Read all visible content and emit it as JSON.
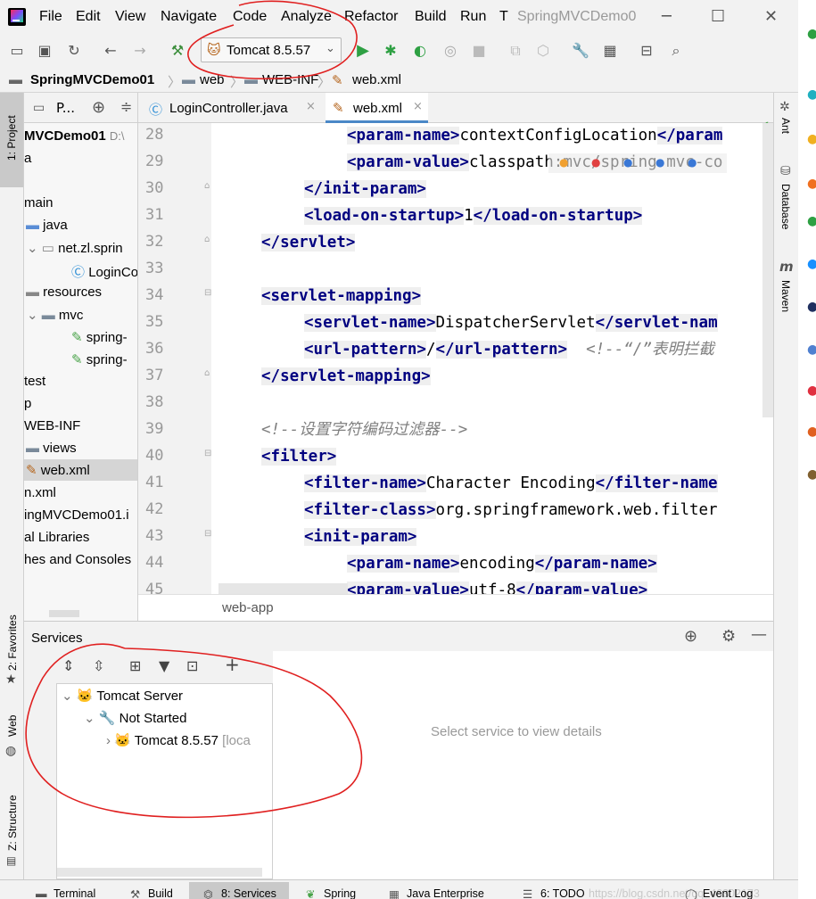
{
  "window": {
    "title": "SpringMVCDemo0"
  },
  "menu": [
    "File",
    "Edit",
    "View",
    "Navigate",
    "Code",
    "Analyze",
    "Refactor",
    "Build",
    "Run",
    "T"
  ],
  "toolbar": {
    "run_config": "Tomcat 8.5.57"
  },
  "breadcrumb": [
    "SpringMVCDemo01",
    "web",
    "WEB-INF",
    "web.xml"
  ],
  "left_stripe": {
    "project": "1: Project",
    "favorites": "2: Favorites",
    "web": "Web",
    "structure": "Z: Structure"
  },
  "project_panel": {
    "header": "P...",
    "root": "MVCDemo01",
    "root_path": "D:\\",
    "items": [
      "a",
      "main",
      "java",
      "net.zl.sprin",
      "LoginCo",
      "resources",
      "mvc",
      "spring-",
      "spring-",
      "test",
      "p",
      "WEB-INF",
      "views",
      "web.xml",
      "n.xml",
      "ingMVCDemo01.i",
      "al Libraries",
      "hes and Consoles"
    ]
  },
  "editor_tabs": [
    {
      "label": "LoginController.java",
      "close": "×"
    },
    {
      "label": "web.xml",
      "close": "×"
    }
  ],
  "gutter_lines": [
    "28",
    "29",
    "30",
    "31",
    "32",
    "33",
    "34",
    "35",
    "36",
    "37",
    "38",
    "39",
    "40",
    "41",
    "42",
    "43",
    "44",
    "45"
  ],
  "code": {
    "l28": {
      "open": "<param-name>",
      "text": "contextConfigLocation",
      "close": "</param"
    },
    "l29": {
      "open": "<param-value>",
      "text": "classpath:mvc/spring-mvc-co"
    },
    "l30": {
      "close": "</init-param>"
    },
    "l31": {
      "open": "<load-on-startup>",
      "text": "1",
      "close": "</load-on-startup>"
    },
    "l32": {
      "close": "</servlet>"
    },
    "l34": {
      "open": "<servlet-mapping>"
    },
    "l35": {
      "open": "<servlet-name>",
      "text": "DispatcherServlet",
      "close": "</servlet-nam"
    },
    "l36": {
      "open": "<url-pattern>",
      "text": "/",
      "close": "</url-pattern>",
      "comment": "<!--“/”表明拦截"
    },
    "l37": {
      "close": "</servlet-mapping>"
    },
    "l39": {
      "comment": "<!--设置字符编码过滤器-->"
    },
    "l40": {
      "open": "<filter>"
    },
    "l41": {
      "open": "<filter-name>",
      "text": "Character Encoding",
      "close": "</filter-name"
    },
    "l42": {
      "open": "<filter-class>",
      "text": "org.springframework.web.filter"
    },
    "l43": {
      "open": "<init-param>"
    },
    "l44": {
      "open": "<param-name>",
      "text": "encoding",
      "close": "</param-name>"
    },
    "l45": {
      "open": "<param-value>",
      "text": "utf-8",
      "close": "</param-value>"
    }
  },
  "editor_crumb": "web-app",
  "right_stripe": {
    "ant": "Ant",
    "database": "Database",
    "maven": "Maven"
  },
  "services": {
    "title": "Services",
    "tree": {
      "server": "Tomcat Server",
      "state": "Not Started",
      "instance": "Tomcat 8.5.57",
      "instance_suffix": "[loca"
    },
    "detail_placeholder": "Select service to view details"
  },
  "statusbar": {
    "terminal": "Terminal",
    "build": "Build",
    "services": "8: Services",
    "spring": "Spring",
    "java_enterprise": "Java Enterprise",
    "todo": "6: TODO",
    "event_log": "Event Log",
    "watermark": "https://blog.csdn.net/qq_46302173"
  },
  "colors": {
    "tag": "#000080",
    "comment": "#808080",
    "annotation": "#e02020",
    "run": "#2ea043"
  }
}
